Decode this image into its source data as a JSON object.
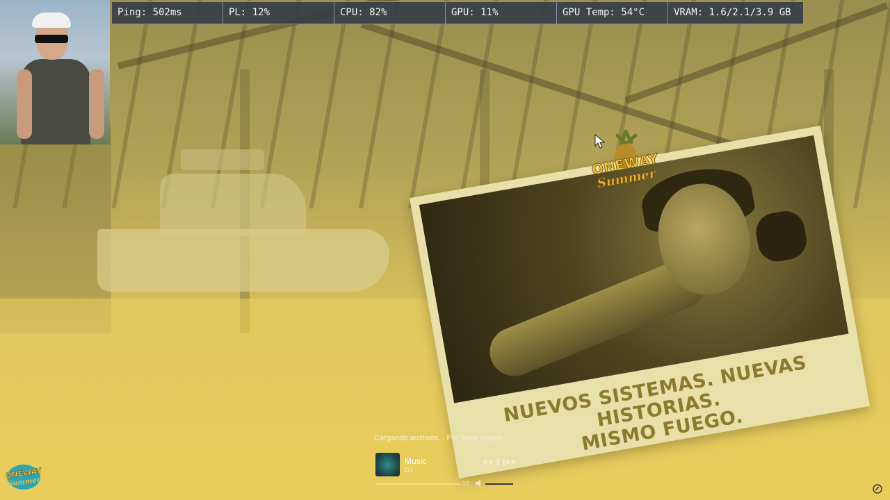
{
  "stats": [
    {
      "label": "Ping: 502ms"
    },
    {
      "label": "PL: 12%"
    },
    {
      "label": "CPU: 82%"
    },
    {
      "label": "GPU: 11%"
    },
    {
      "label": "GPU Temp: 54°C"
    },
    {
      "label": "VRAM: 1.6/2.1/3.9 GB"
    }
  ],
  "promo": {
    "logo_line1": "ONEWAY",
    "logo_line2": "Summer",
    "headline_line1": "NUEVOS SISTEMAS. NUEVAS HISTORIAS.",
    "headline_line2": "MISMO FUEGO."
  },
  "loading": {
    "text": "Cargando archivos... Por favor espere."
  },
  "player": {
    "title": "Music",
    "artist": "DJ",
    "progress": 0.0,
    "timecode": "0:0"
  },
  "brand_logo": {
    "line1": "ONEWAY",
    "line2": "Summer"
  },
  "colors": {
    "background": "#d4bd5a",
    "stats_bg": "#373e48",
    "stats_border": "#7f93a8",
    "headline": "#8c7a2e",
    "card": "#e9dfa8"
  },
  "icons": [
    "cursor-icon",
    "rewind-icon",
    "pause-icon",
    "forward-icon",
    "volume-icon",
    "corner-icon"
  ]
}
